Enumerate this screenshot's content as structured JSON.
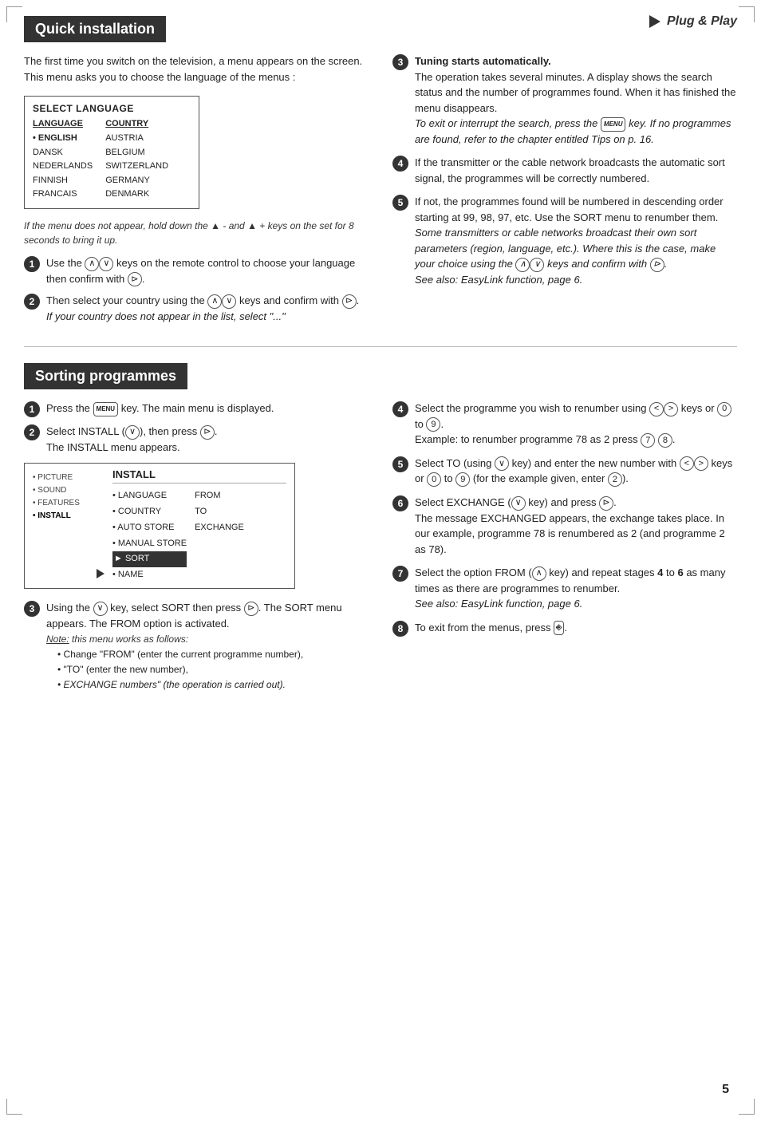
{
  "plugPlay": {
    "label": "Plug & Play"
  },
  "quickInstall": {
    "title": "Quick installation",
    "intro": "The first time you switch on the television, a menu appears on the screen. This menu asks you to choose the language of the menus :",
    "langBox": {
      "title": "SELECT LANGUAGE",
      "langHeader": "LANGUAGE",
      "countryHeader": "COUNTRY",
      "languages": [
        "ENGLISH",
        "DANSK",
        "NEDERLANDS",
        "FINNISH",
        "FRANCAIS"
      ],
      "countries": [
        "AUSTRIA",
        "BELGIUM",
        "SWITZERLAND",
        "GERMANY",
        "DENMARK"
      ]
    },
    "italicNote": "If the menu does not appear, hold down the  ▲  - and  ▲  + keys on the set for 8 seconds to bring it up.",
    "steps": [
      {
        "num": "1",
        "text": "Use the  keys on the remote control to choose your language then confirm with  ."
      },
      {
        "num": "2",
        "text": "Then select your country using the   keys and confirm with  .",
        "italic": "If your country does not appear in the list, select \"...\""
      }
    ],
    "rightSteps": [
      {
        "num": "3",
        "bold": "Tuning starts automatically.",
        "text": "The operation takes several minutes. A display shows the search status and the number of programmes found. When it has finished the menu disappears.",
        "italic": "To exit or interrupt the search, press the  key. If no programmes are found, refer to the chapter entitled Tips on p. 16."
      },
      {
        "num": "4",
        "text": "If the transmitter or the cable network broadcasts the automatic sort signal, the programmes will be correctly numbered."
      },
      {
        "num": "5",
        "text": "If not, the programmes found will be numbered in descending order starting at 99, 98, 97, etc. Use the SORT menu to renumber them.",
        "italic": "Some transmitters or cable networks broadcast their own sort parameters (region, language, etc.). Where this is the case, make your choice using the   keys and confirm with  .",
        "italic2": "See also: EasyLink function, page 6."
      }
    ]
  },
  "sortingProgrammes": {
    "title": "Sorting programmes",
    "steps": [
      {
        "num": "1",
        "text": "Press the  key. The main menu is displayed."
      },
      {
        "num": "2",
        "text": "Select INSTALL ( ), then press  .",
        "sub": "The INSTALL menu appears."
      }
    ],
    "installMenu": {
      "title": "INSTALL",
      "sidebar": [
        "• PICTURE",
        "• SOUND",
        "• FEATURES",
        "• INSTALL"
      ],
      "items": [
        "• LANGUAGE",
        "• COUNTRY",
        "• AUTO STORE",
        "• MANUAL STORE",
        "► SORT",
        "• NAME"
      ],
      "fromLabel": "FROM",
      "toLabel": "TO",
      "exchangeLabel": "EXCHANGE"
    },
    "step3": {
      "num": "3",
      "text": "Using the  key, select SORT then press  . The SORT menu appears. The FROM option is activated.",
      "noteTitle": "Note:",
      "noteText": "this menu works as follows:",
      "bullets": [
        "Change \"FROM\" (enter the current programme number),",
        "\"TO\" (enter the new number),",
        "EXCHANGE numbers\" (the operation is carried out)."
      ]
    },
    "rightSteps": [
      {
        "num": "4",
        "text": "Select the programme you wish to renumber using   keys or  to  .",
        "sub": "Example: to renumber programme 78 as 2 press  ."
      },
      {
        "num": "5",
        "text": "Select TO (using  key) and enter the new number with   keys or  to  (for the example given, enter  )."
      },
      {
        "num": "6",
        "text": "Select EXCHANGE ( key) and press  .",
        "sub": "The message EXCHANGED appears, the exchange takes place. In our example, programme 78 is renumbered as 2 (and programme 2 as 78)."
      },
      {
        "num": "7",
        "text": "Select the option FROM ( key) and repeat stages  to  as many times as there are programmes to renumber.",
        "italic": "See also: EasyLink function, page 6."
      },
      {
        "num": "8",
        "text": "To exit from the menus, press  ."
      }
    ]
  },
  "pageNumber": "5"
}
